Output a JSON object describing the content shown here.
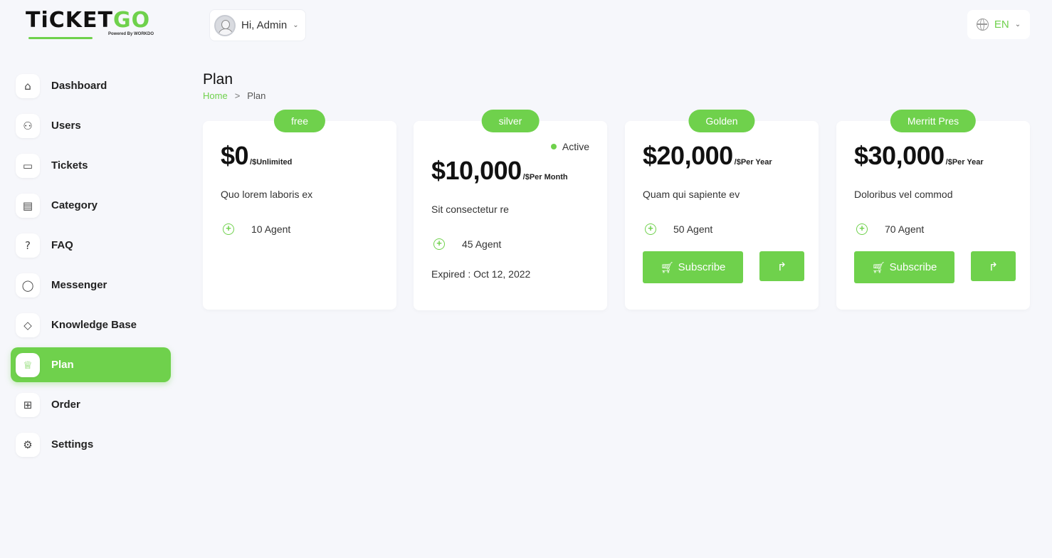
{
  "brand": {
    "name_part1": "TiCKET",
    "name_part2": "GO",
    "tagline": "Powered By WORKDO",
    "accent_color": "#6fd14c"
  },
  "user_menu": {
    "greeting": "Hi, Admin",
    "chevron": "⌄"
  },
  "language": {
    "code": "EN",
    "chevron": "⌄",
    "icon": "globe-icon"
  },
  "sidebar": {
    "items": [
      {
        "label": "Dashboard",
        "icon": "home-icon",
        "glyph": "⌂"
      },
      {
        "label": "Users",
        "icon": "users-icon",
        "glyph": "⚇"
      },
      {
        "label": "Tickets",
        "icon": "ticket-icon",
        "glyph": "▭"
      },
      {
        "label": "Category",
        "icon": "clipboard-icon",
        "glyph": "▤"
      },
      {
        "label": "FAQ",
        "icon": "question-icon",
        "glyph": "?"
      },
      {
        "label": "Messenger",
        "icon": "chat-icon",
        "glyph": "◯"
      },
      {
        "label": "Knowledge Base",
        "icon": "graduation-cap-icon",
        "glyph": "◇"
      },
      {
        "label": "Plan",
        "icon": "trophy-icon",
        "glyph": "♕",
        "active": true
      },
      {
        "label": "Order",
        "icon": "cart-icon",
        "glyph": "⊞"
      },
      {
        "label": "Settings",
        "icon": "gear-icon",
        "glyph": "⚙"
      }
    ]
  },
  "page": {
    "title": "Plan",
    "breadcrumb": {
      "home": "Home",
      "separator": ">",
      "current": "Plan"
    }
  },
  "plans": [
    {
      "name": "free",
      "price": "$0",
      "duration": "/$Unlimited",
      "description": "Quo lorem laboris ex",
      "agents": "10 Agent"
    },
    {
      "name": "silver",
      "status": "Active",
      "price": "$10,000",
      "duration": "/$Per Month",
      "description": "Sit consectetur re",
      "agents": "45 Agent",
      "expired": "Expired : Oct 12, 2022"
    },
    {
      "name": "Golden",
      "price": "$20,000",
      "duration": "/$Per Year",
      "description": "Quam qui sapiente ev",
      "agents": "50 Agent",
      "subscribe_label": "Subscribe",
      "share_glyph": "↱"
    },
    {
      "name": "Merritt Pres",
      "price": "$30,000",
      "duration": "/$Per Year",
      "description": "Doloribus vel commod",
      "agents": "70 Agent",
      "subscribe_label": "Subscribe",
      "share_glyph": "↱"
    }
  ]
}
